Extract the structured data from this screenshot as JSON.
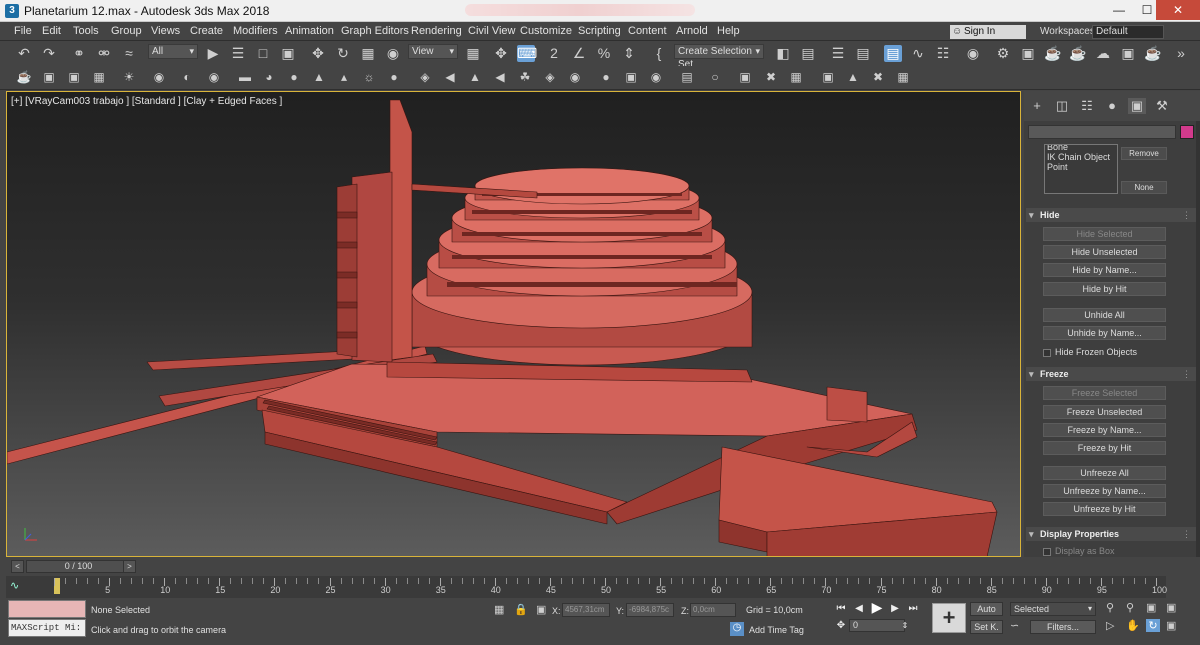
{
  "window": {
    "title": "Planetarium 12.max - Autodesk 3ds Max 2018",
    "minimize": "—",
    "maximize": "☐",
    "close": "✕"
  },
  "menu": [
    "File",
    "Edit",
    "Tools",
    "Group",
    "Views",
    "Create",
    "Modifiers",
    "Animation",
    "Graph Editors",
    "Rendering",
    "Civil View",
    "Customize",
    "Scripting",
    "Content",
    "Arnold",
    "Help"
  ],
  "account": {
    "signin": "Sign In",
    "workspaces_label": "Workspaces:",
    "workspace": "Default"
  },
  "toolbar": {
    "selection_filter": "All",
    "ref_coord": "View",
    "selection_set": "Create Selection Set"
  },
  "viewport": {
    "label": "[+] [VRayCam003 trabajo ] [Standard ] [Clay + Edged Faces ]",
    "model_color": "#c8574e"
  },
  "command_panel": {
    "list_items": [
      "Bone",
      "IK Chain Object",
      "Point"
    ],
    "remove": "Remove",
    "none": "None",
    "hide": {
      "title": "Hide",
      "buttons": [
        "Hide Selected",
        "Hide Unselected",
        "Hide by Name...",
        "Hide by Hit",
        "Unhide All",
        "Unhide by Name..."
      ],
      "checkbox": "Hide Frozen Objects"
    },
    "freeze": {
      "title": "Freeze",
      "buttons": [
        "Freeze Selected",
        "Freeze Unselected",
        "Freeze by Name...",
        "Freeze by Hit",
        "Unfreeze All",
        "Unfreeze by Name...",
        "Unfreeze by Hit"
      ]
    },
    "display": {
      "title": "Display Properties",
      "checkbox": "Display as Box"
    },
    "swatch_color": "#d23a8c"
  },
  "timeline": {
    "frame": "0 / 100",
    "prev": "<",
    "next": ">",
    "ticks": [
      "0",
      "5",
      "10",
      "15",
      "20",
      "25",
      "30",
      "35",
      "40",
      "45",
      "50",
      "55",
      "60",
      "65",
      "70",
      "75",
      "80",
      "85",
      "90",
      "95",
      "100"
    ]
  },
  "status": {
    "maxscript": "MAXScript Mi:",
    "selection": "None Selected",
    "prompt": "Click and drag to orbit the camera",
    "x_label": "X:",
    "x_val": "4567,31cm",
    "y_label": "Y:",
    "y_val": "-6984,875c",
    "z_label": "Z:",
    "z_val": "0,0cm",
    "grid": "Grid = 10,0cm",
    "add_time_tag": "Add Time Tag",
    "auto": "Auto",
    "set_key": "Set K.",
    "key_filter": "Selected",
    "filters": "Filters...",
    "current_frame": "0"
  }
}
